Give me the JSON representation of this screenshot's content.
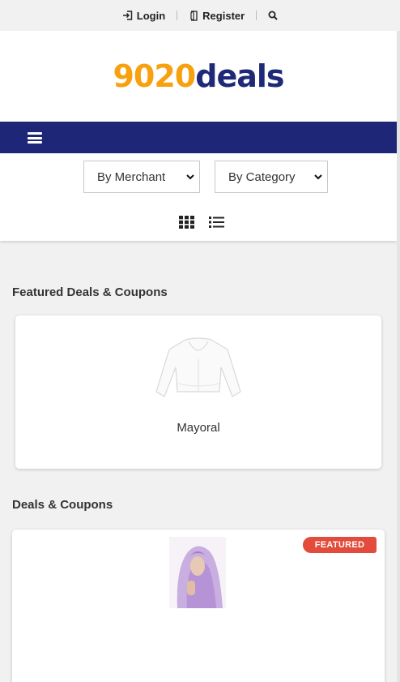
{
  "topbar": {
    "login_label": "Login",
    "register_label": "Register",
    "search_icon": "search-icon"
  },
  "logo": {
    "number": "9020",
    "word": "deals",
    "number_color": "#f7a10f",
    "word_color": "#1e2a78"
  },
  "navbar": {
    "background": "#1d2677",
    "menu_icon": "hamburger-icon"
  },
  "filters": {
    "merchant_select": "By Merchant",
    "category_select": "By Category",
    "view_grid_icon": "grid-view-icon",
    "view_list_icon": "list-view-icon"
  },
  "featured": {
    "title": "Featured Deals & Coupons",
    "items": [
      {
        "name": "Mayoral",
        "image_icon": "white-cardigan-image"
      }
    ]
  },
  "deals": {
    "title": "Deals & Coupons",
    "items": [
      {
        "badge": "FEATURED",
        "badge_color": "#e34c3c",
        "image_icon": "lilac-hijab-image"
      }
    ]
  }
}
